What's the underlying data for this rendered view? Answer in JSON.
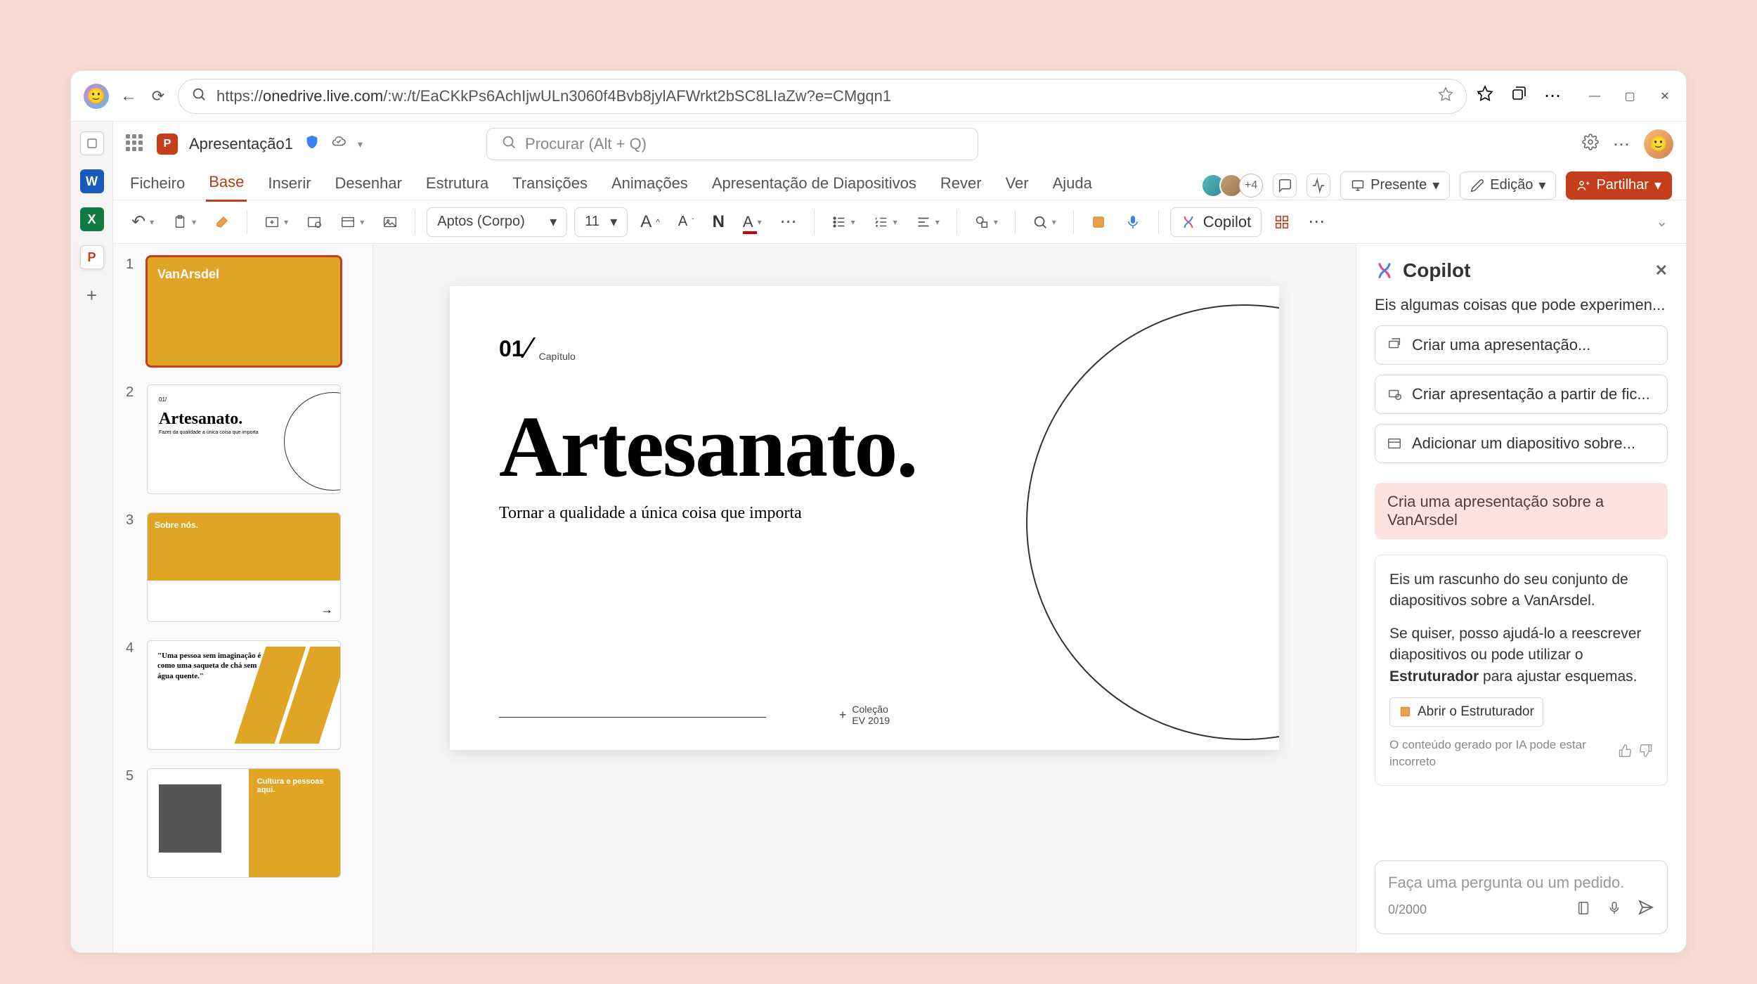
{
  "browser": {
    "url_host": "onedrive.live.com",
    "url_path": "/:w:/t/EaCKkPs6AchIjwULn3060f4Bvb8jylAFWrkt2bSC8LIaZw?e=CMgqn1"
  },
  "title_row": {
    "doc_name": "Apresentação1",
    "search_placeholder": "Procurar (Alt + Q)"
  },
  "ribbon": {
    "tabs": [
      "Ficheiro",
      "Base",
      "Inserir",
      "Desenhar",
      "Estrutura",
      "Transições",
      "Animações",
      "Apresentação de Diapositivos",
      "Rever",
      "Ver",
      "Ajuda"
    ],
    "active_index": 1,
    "collab_more": "+4",
    "present": "Presente",
    "editing": "Edição",
    "share": "Partilhar"
  },
  "toolbar": {
    "font_name": "Aptos (Corpo)",
    "font_size": "11",
    "bold": "N",
    "copilot": "Copilot"
  },
  "thumbs": [
    {
      "n": "1"
    },
    {
      "n": "2"
    },
    {
      "n": "3"
    },
    {
      "n": "4"
    },
    {
      "n": "5"
    }
  ],
  "thumb_content": {
    "t1_brand": "VanArsdel",
    "t2_title": "Artesanato.",
    "t2_sub": "Fazer da qualidade a única coisa que importa",
    "t3_title": "Sobre nós.",
    "t4_quote": "\"Uma pessoa sem imaginação é como uma saqueta de chá sem água quente.\"",
    "t5_title": "Cultura e pessoas aqui."
  },
  "slide": {
    "num": "01",
    "caption": "Capítulo",
    "title": "Artesanato.",
    "subtitle": "Tornar a qualidade a única coisa que importa",
    "meta1": "Coleção",
    "meta2": "EV 2019"
  },
  "copilot": {
    "title": "Copilot",
    "intro": "Eis algumas coisas que pode experimen...",
    "sug1": "Criar uma apresentação...",
    "sug2": "Criar apresentação a partir de fic...",
    "sug3": "Adicionar um diapositivo sobre...",
    "user_prompt": "Cria uma apresentação sobre a VanArsdel",
    "reply_p1": "Eis um rascunho do seu conjunto de diapositivos sobre a VanArsdel.",
    "reply_p2a": "Se quiser, posso ajudá-lo a reescrever diapositivos ou pode utilizar o ",
    "reply_p2b": "Estruturador",
    "reply_p2c": " para ajustar esquemas.",
    "open_designer": "Abrir o Estruturador",
    "disclaimer": "O conteúdo gerado por IA pode estar incorreto",
    "input_placeholder": "Faça uma pergunta ou um pedido.",
    "counter": "0/2000"
  }
}
